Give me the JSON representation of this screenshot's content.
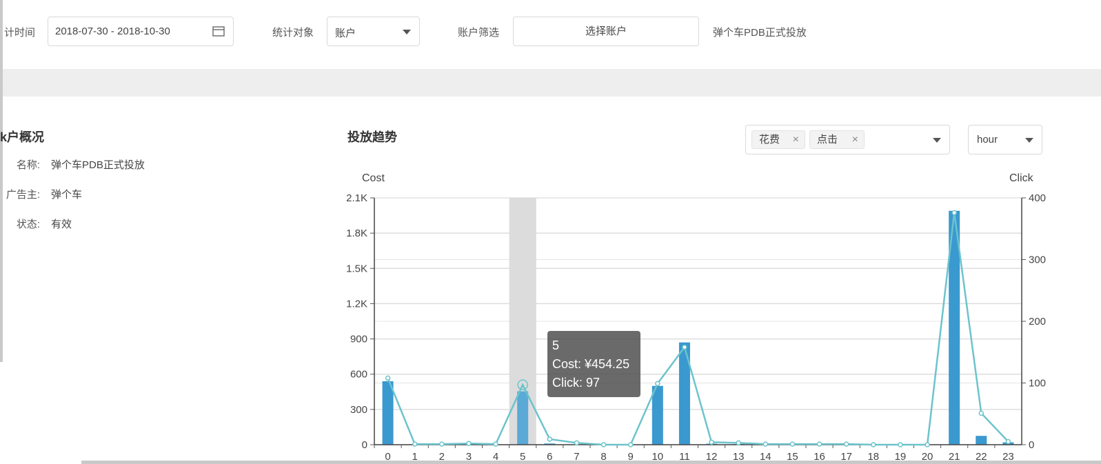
{
  "filters": {
    "time_label": "计时间",
    "date_range": "2018-07-30 - 2018-10-30",
    "object_label": "统计对象",
    "object_value": "账户",
    "account_filter_label": "账户筛选",
    "select_account_button": "选择账户",
    "selected_account": "弹个车PDB正式投放"
  },
  "overview": {
    "title": "k户概况",
    "rows": [
      {
        "key": "名称:",
        "value": "弹个车PDB正式投放"
      },
      {
        "key": "广告主:",
        "value": "弹个车"
      },
      {
        "key": "状态:",
        "value": "有效"
      }
    ]
  },
  "trend": {
    "title": "投放趋势",
    "metric_tags": [
      "花费",
      "点击"
    ],
    "granularity": "hour"
  },
  "tooltip": {
    "title": "5",
    "cost_line": "Cost: ¥454.25",
    "click_line": "Click: 97"
  },
  "chart_data": {
    "type": "bar+line",
    "categories": [
      "0",
      "1",
      "2",
      "3",
      "4",
      "5",
      "6",
      "7",
      "8",
      "9",
      "10",
      "11",
      "12",
      "13",
      "14",
      "15",
      "16",
      "17",
      "18",
      "19",
      "20",
      "21",
      "22",
      "23"
    ],
    "y_left": {
      "label": "Cost",
      "ticks": [
        "0",
        "300",
        "600",
        "900",
        "1.2K",
        "1.5K",
        "1.8K",
        "2.1K"
      ],
      "range": [
        0,
        2100
      ]
    },
    "y_right": {
      "label": "Click",
      "ticks": [
        "0",
        "100",
        "200",
        "300",
        "400"
      ],
      "range": [
        0,
        400
      ]
    },
    "series": [
      {
        "name": "Cost",
        "type": "bar",
        "color": "#3a99cf",
        "values": [
          540,
          0,
          0,
          0,
          0,
          454.25,
          10,
          0,
          5,
          0,
          500,
          870,
          8,
          5,
          0,
          0,
          0,
          0,
          0,
          0,
          0,
          1990,
          75,
          20
        ]
      },
      {
        "name": "Click",
        "type": "line",
        "color": "#6cc3cc",
        "values": [
          108,
          1,
          1,
          2,
          1,
          97,
          9,
          3,
          0,
          0,
          99,
          158,
          4,
          3,
          1,
          1,
          1,
          1,
          0,
          0,
          0,
          376,
          51,
          5
        ]
      }
    ],
    "highlight_index": 5
  }
}
